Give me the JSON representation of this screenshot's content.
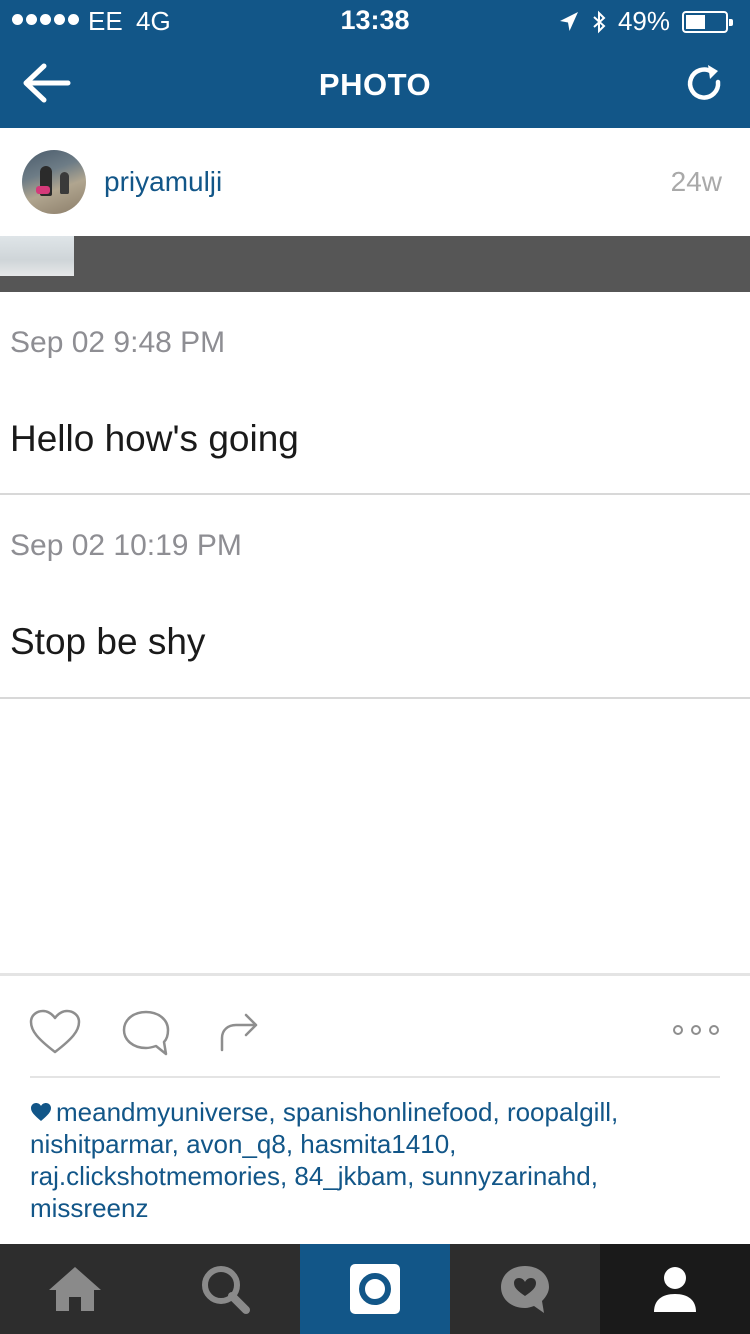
{
  "status_bar": {
    "carrier": "EE",
    "network": "4G",
    "time": "13:38",
    "battery": "49%",
    "battery_level": 0.49,
    "signal_bars": 5
  },
  "nav": {
    "title": "PHOTO",
    "back_icon": "back-arrow-icon",
    "refresh_icon": "refresh-icon"
  },
  "post": {
    "username": "priyamulji",
    "age": "24w"
  },
  "messages": [
    {
      "time": "Sep 02 9:48 PM",
      "text": "Hello how's going"
    },
    {
      "time": "Sep 02 10:19 PM",
      "text": "Stop be shy"
    }
  ],
  "likes": {
    "text": "meandmyuniverse, spanishonlinefood, roopalgill, nishitparmar, avon_q8, hasmita1410, raj.clickshotmemories, 84_jkbam, sunnyzarinahd, missreenz"
  },
  "tabs": [
    {
      "id": "home",
      "icon": "home-icon"
    },
    {
      "id": "search",
      "icon": "search-icon"
    },
    {
      "id": "camera",
      "icon": "camera-icon"
    },
    {
      "id": "activity",
      "icon": "activity-icon"
    },
    {
      "id": "profile",
      "icon": "profile-icon"
    }
  ],
  "colors": {
    "brand": "#125688",
    "tab_dark": "#2d2d2d",
    "text_gray": "#8e8e93"
  }
}
